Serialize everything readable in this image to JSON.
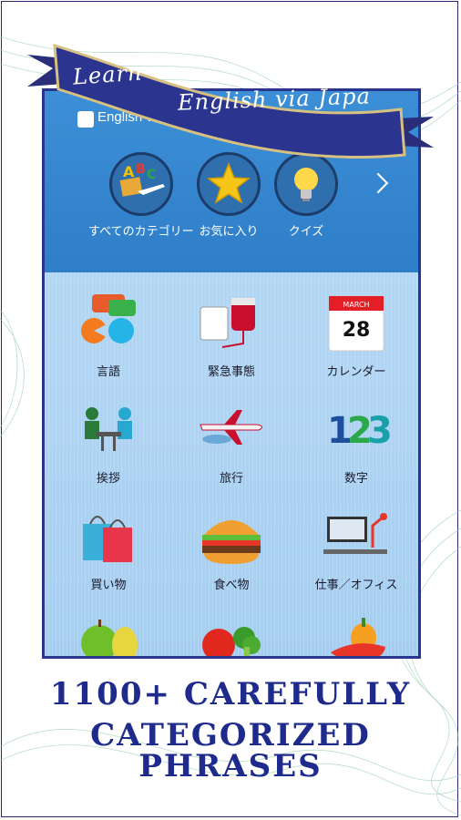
{
  "banner": {
    "line1": "Learn",
    "line2": "English via Japa"
  },
  "app_bar": {
    "title": "English via Jap"
  },
  "features": [
    {
      "label": "すべてのカテゴリー",
      "icon": "abc-airplane-icon"
    },
    {
      "label": "お気に入り",
      "icon": "star-icon"
    },
    {
      "label": "クイズ",
      "icon": "lightbulb-icon"
    }
  ],
  "categories": [
    {
      "label": "言語",
      "icon": "speech-bubbles-icon"
    },
    {
      "label": "緊急事態",
      "icon": "blood-bag-icon"
    },
    {
      "label": "カレンダー",
      "icon": "calendar-icon",
      "month": "MARCH",
      "day": "28"
    },
    {
      "label": "挨拶",
      "icon": "meeting-icon"
    },
    {
      "label": "旅行",
      "icon": "airplane-icon"
    },
    {
      "label": "数字",
      "icon": "numbers-icon",
      "digits": [
        "1",
        "2",
        "3"
      ]
    },
    {
      "label": "買い物",
      "icon": "shopping-bags-icon"
    },
    {
      "label": "食べ物",
      "icon": "burger-icon"
    },
    {
      "label": "仕事／オフィス",
      "icon": "office-desk-icon"
    },
    {
      "icon": "fruits-icon"
    },
    {
      "icon": "vegetables-icon"
    },
    {
      "icon": "peppers-icon"
    }
  ],
  "caption": {
    "line1": "1100+ CAREFULLY",
    "line2": "CATEGORIZED PHRASES"
  },
  "colors": {
    "navy": "#1e2a8c",
    "header_blue": "#3c8fd6",
    "grid_blue": "#b3d6f2"
  }
}
